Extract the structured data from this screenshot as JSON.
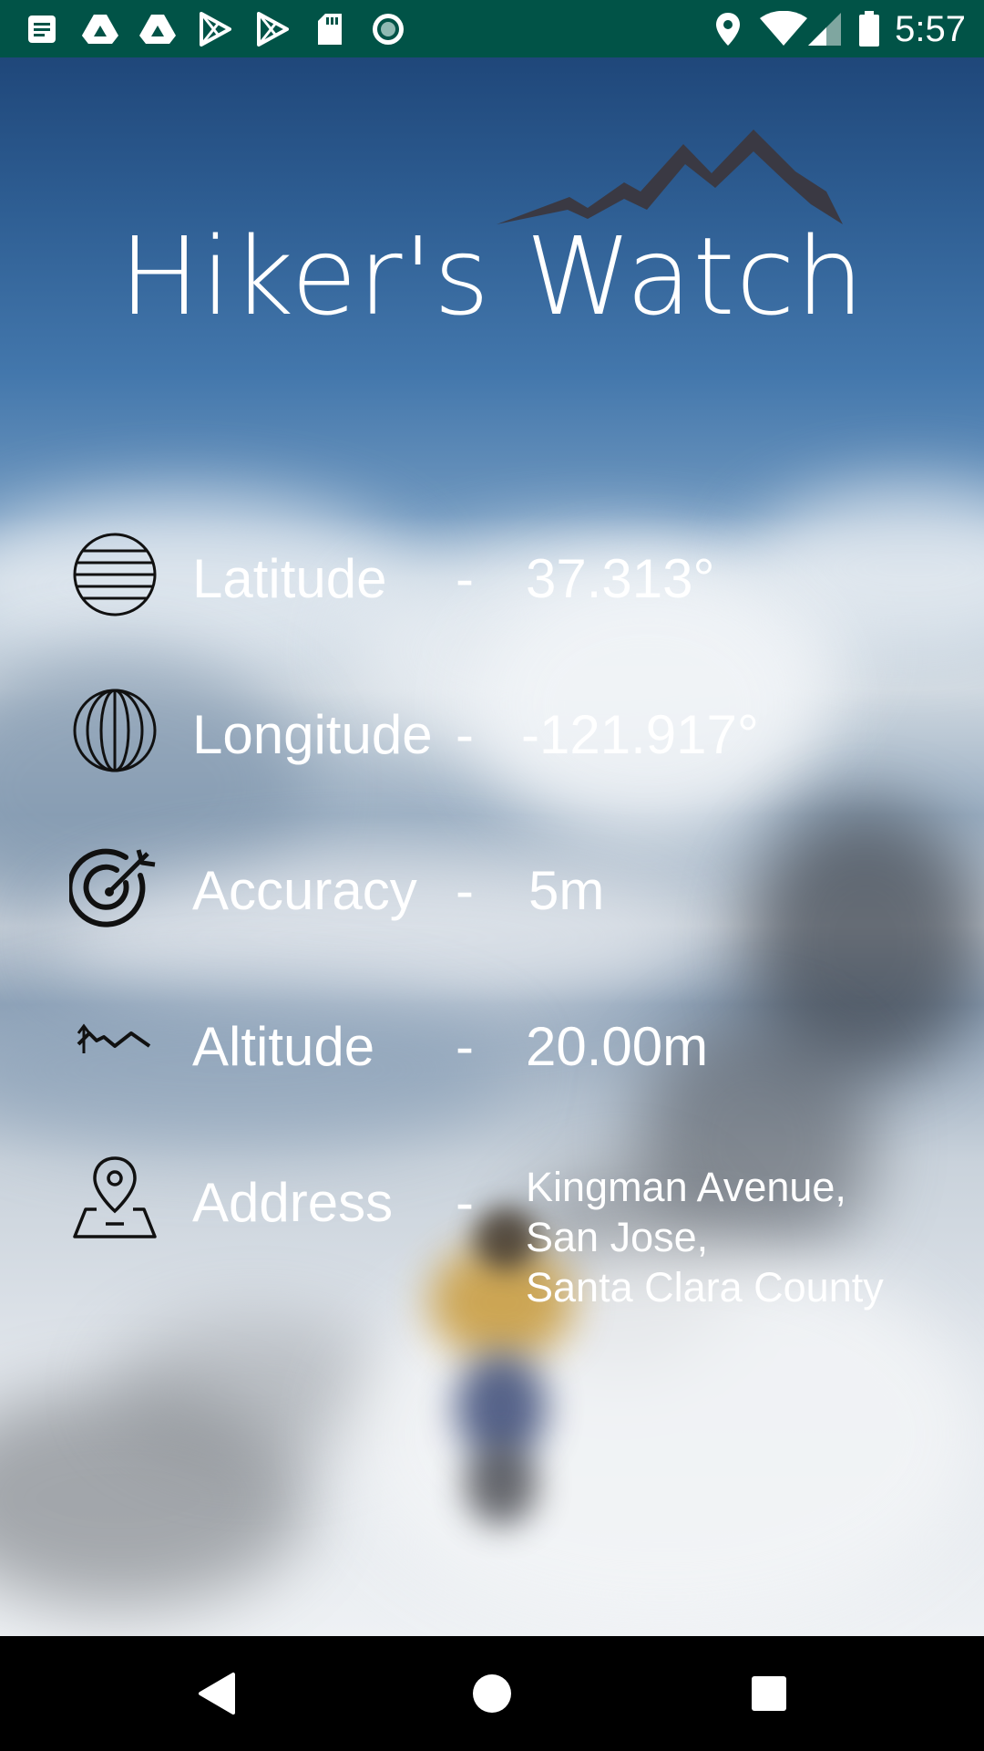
{
  "status_bar": {
    "time": "5:57",
    "left_icons": [
      "notes-icon",
      "drive-icon",
      "drive-icon",
      "play-store-icon",
      "play-store-icon",
      "sd-card-icon",
      "record-icon"
    ],
    "right_icons": [
      "location-icon",
      "wifi-icon",
      "signal-icon",
      "battery-icon"
    ],
    "background_color": "#015347"
  },
  "app": {
    "title": "Hiker's Watch"
  },
  "rows": [
    {
      "icon": "globe-latitude-icon",
      "label": "Latitude",
      "separator": "-",
      "value": "37.313°"
    },
    {
      "icon": "globe-longitude-icon",
      "label": "Longitude",
      "separator": "-",
      "value": "-121.917°"
    },
    {
      "icon": "target-icon",
      "label": "Accuracy",
      "separator": "-",
      "value": "5m"
    },
    {
      "icon": "altitude-icon",
      "label": "Altitude",
      "separator": "-",
      "value": "20.00m"
    },
    {
      "icon": "map-pin-icon",
      "label": "Address",
      "separator": "-",
      "value_lines": [
        "Kingman Avenue,",
        "San Jose,",
        "Santa Clara County"
      ]
    }
  ],
  "nav_bar": {
    "buttons": [
      "back-icon",
      "home-icon",
      "recents-icon"
    ]
  }
}
